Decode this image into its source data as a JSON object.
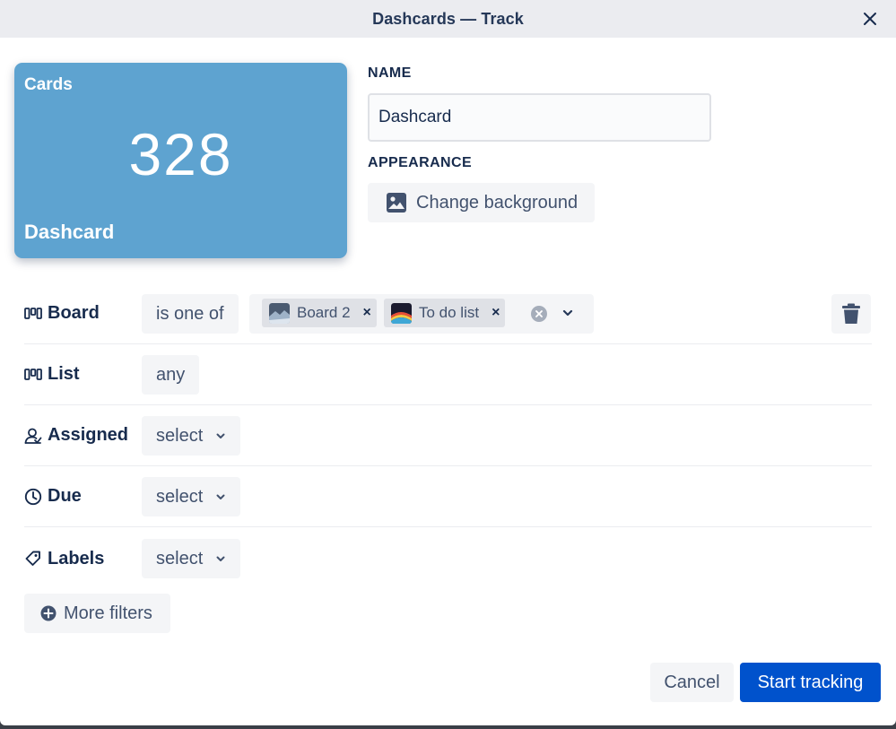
{
  "modal": {
    "title": "Dashcards — Track",
    "close_icon": "close-icon"
  },
  "preview": {
    "top_label": "Cards",
    "count": "328",
    "bottom_label": "Dashcard",
    "color": "#5ea3d0"
  },
  "name_section": {
    "label": "NAME",
    "value": "Dashcard"
  },
  "appearance_section": {
    "label": "APPEARANCE",
    "button_label": "Change background",
    "icon": "image-icon"
  },
  "filters": {
    "board": {
      "label": "Board",
      "icon": "board-icon",
      "operator": "is one of",
      "tags": [
        {
          "label": "Board 2"
        },
        {
          "label": "To do list"
        }
      ],
      "remove_tag_glyph": "×"
    },
    "list": {
      "label": "List",
      "icon": "board-icon",
      "value": "any"
    },
    "assigned": {
      "label": "Assigned",
      "icon": "assignee-icon",
      "value": "select"
    },
    "due": {
      "label": "Due",
      "icon": "clock-icon",
      "value": "select"
    },
    "labels": {
      "label": "Labels",
      "icon": "tag-icon",
      "value": "select"
    }
  },
  "more_filters": {
    "label": "More filters",
    "icon": "plus-circle-icon"
  },
  "footer": {
    "cancel_label": "Cancel",
    "start_label": "Start tracking",
    "primary_color": "#0052cc"
  }
}
